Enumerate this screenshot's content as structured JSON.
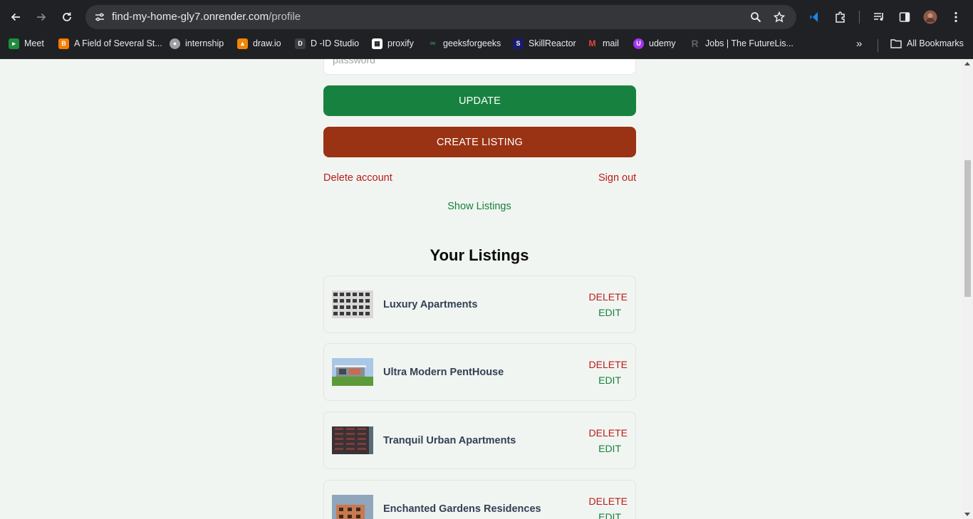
{
  "browser": {
    "url_host": "find-my-home-gly7.onrender.com",
    "url_path": "/profile",
    "bookmarks": [
      {
        "label": "Meet",
        "icon": "meet-icon",
        "color": "#1e8e3e"
      },
      {
        "label": "A Field of Several St...",
        "icon": "blogger-icon",
        "color": "#f57d00"
      },
      {
        "label": "internship",
        "icon": "globe-icon",
        "color": "#9aa0a6"
      },
      {
        "label": "draw.io",
        "icon": "drawio-icon",
        "color": "#f08705"
      },
      {
        "label": "D -ID Studio",
        "icon": "did-icon",
        "color": "#3c4043"
      },
      {
        "label": "proxify",
        "icon": "proxify-icon",
        "color": "#ffffff"
      },
      {
        "label": "geeksforgeeks",
        "icon": "gfg-icon",
        "color": "#2f8d46"
      },
      {
        "label": "SkillReactor",
        "icon": "skillreactor-icon",
        "color": "#1a1a6e"
      },
      {
        "label": "mail",
        "icon": "gmail-icon",
        "color": "#ea4335"
      },
      {
        "label": "udemy",
        "icon": "udemy-icon",
        "color": "#a435f0"
      },
      {
        "label": "Jobs | The FutureLis...",
        "icon": "futurelist-icon",
        "color": "#5f6368"
      }
    ],
    "all_bookmarks_label": "All Bookmarks"
  },
  "profile": {
    "password_placeholder": "password",
    "update_label": "UPDATE",
    "create_listing_label": "CREATE LISTING",
    "delete_account_label": "Delete account",
    "sign_out_label": "Sign out",
    "show_listings_label": "Show Listings",
    "colors": {
      "update": "#178240",
      "create": "#9a3314",
      "danger": "#b91c1c",
      "success": "#15803d"
    }
  },
  "listings": {
    "title": "Your Listings",
    "delete_label": "DELETE",
    "edit_label": "EDIT",
    "items": [
      {
        "name": "Luxury Apartments",
        "thumb": "bw-facade"
      },
      {
        "name": "Ultra Modern PentHouse",
        "thumb": "modern-house"
      },
      {
        "name": "Tranquil Urban Apartments",
        "thumb": "dark-tower"
      },
      {
        "name": "Enchanted Gardens Residences",
        "thumb": "orange-building"
      }
    ]
  }
}
